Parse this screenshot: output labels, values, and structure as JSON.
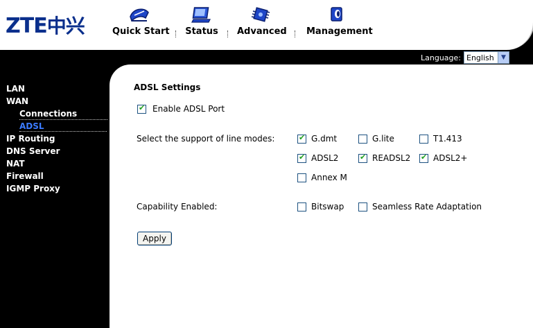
{
  "brand": {
    "logo_text": "ZTE",
    "logo_cn": "中兴"
  },
  "nav": {
    "items": [
      {
        "label": "Quick Start",
        "icon": "quick-start-icon"
      },
      {
        "label": "Status",
        "icon": "monitor-icon"
      },
      {
        "label": "Advanced",
        "icon": "chip-icon"
      },
      {
        "label": "Management",
        "icon": "management-icon"
      }
    ]
  },
  "language": {
    "label": "Language:",
    "value": "English"
  },
  "sidebar": {
    "items": [
      {
        "label": "LAN"
      },
      {
        "label": "WAN"
      },
      {
        "label": "Connections"
      },
      {
        "label": "ADSL"
      },
      {
        "label": "IP Routing"
      },
      {
        "label": "DNS Server"
      },
      {
        "label": "NAT"
      },
      {
        "label": "Firewall"
      },
      {
        "label": "IGMP Proxy"
      }
    ]
  },
  "main": {
    "heading": "ADSL Settings",
    "enable_port": {
      "label": "Enable ADSL Port",
      "checked": true
    },
    "line_modes_label": "Select the support of line modes:",
    "line_modes": [
      {
        "label": "G.dmt",
        "checked": true
      },
      {
        "label": "G.lite",
        "checked": false
      },
      {
        "label": "T1.413",
        "checked": false
      },
      {
        "label": "ADSL2",
        "checked": true
      },
      {
        "label": "READSL2",
        "checked": true
      },
      {
        "label": "ADSL2+",
        "checked": true
      },
      {
        "label": "Annex M",
        "checked": false
      }
    ],
    "capability_label": "Capability Enabled:",
    "capabilities": [
      {
        "label": "Bitswap",
        "checked": false
      },
      {
        "label": "Seamless Rate Adaptation",
        "checked": false
      }
    ],
    "apply_label": "Apply"
  },
  "colors": {
    "brand_blue": "#0a2f8c",
    "active_link": "#3b7bff",
    "check_green": "#21a121"
  }
}
